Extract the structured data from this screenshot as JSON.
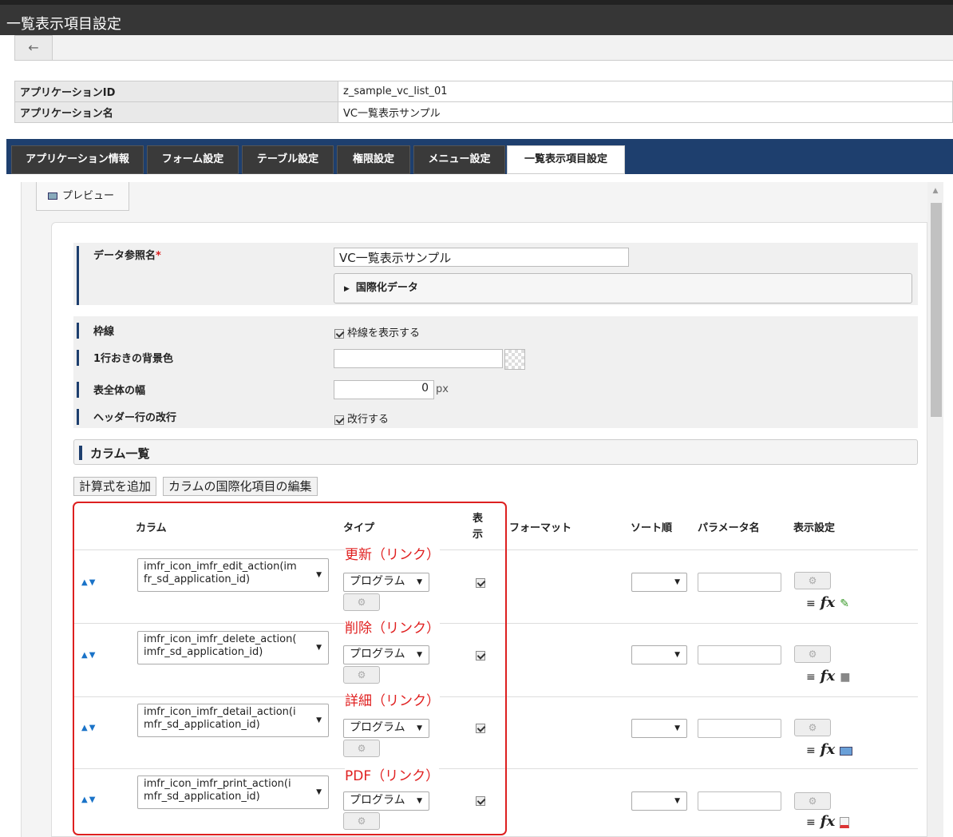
{
  "window": {
    "title": "一覧表示項目設定",
    "back_icon": "←"
  },
  "app_info": {
    "rows": [
      {
        "label": "アプリケーションID",
        "value": "z_sample_vc_list_01"
      },
      {
        "label": "アプリケーション名",
        "value": "VC一覧表示サンプル"
      }
    ]
  },
  "tabs": [
    {
      "label": "アプリケーション情報",
      "active": false
    },
    {
      "label": "フォーム設定",
      "active": false
    },
    {
      "label": "テーブル設定",
      "active": false
    },
    {
      "label": "権限設定",
      "active": false
    },
    {
      "label": "メニュー設定",
      "active": false
    },
    {
      "label": "一覧表示項目設定",
      "active": true
    }
  ],
  "preview_tab": "プレビュー",
  "form": {
    "data_ref_label": "データ参照名",
    "data_ref_required": "*",
    "data_ref_value": "VC一覧表示サンプル",
    "i18n_label": "国際化データ",
    "border_label": "枠線",
    "border_check": "枠線を表示する",
    "alt_bg_label": "1行おきの背景色",
    "table_width_label": "表全体の幅",
    "table_width_value": "0",
    "table_width_unit": "px",
    "header_wrap_label": "ヘッダー行の改行",
    "header_wrap_check": "改行する"
  },
  "column_section": {
    "title": "カラム一覧",
    "add_formula": "計算式を追加",
    "edit_i18n": "カラムの国際化項目の編集"
  },
  "grid": {
    "headers": {
      "column": "カラム",
      "type": "タイプ",
      "show": "表示",
      "format": "フォーマット",
      "sort": "ソート順",
      "param": "パラメータ名",
      "display": "表示設定"
    },
    "rows": [
      {
        "note": "更新（リンク）",
        "column_line1": "imfr_icon_imfr_edit_action(im",
        "column_line2": "fr_sd_application_id)",
        "type": "プログラム",
        "extra_icon": "pencil-icon"
      },
      {
        "note": "削除（リンク）",
        "column_line1": "imfr_icon_imfr_delete_action(",
        "column_line2": "imfr_sd_application_id)",
        "type": "プログラム",
        "extra_icon": "trash-icon"
      },
      {
        "note": "詳細（リンク）",
        "column_line1": "imfr_icon_imfr_detail_action(i",
        "column_line2": "mfr_sd_application_id)",
        "type": "プログラム",
        "extra_icon": "detail-icon"
      },
      {
        "note": "PDF（リンク）",
        "column_line1": "imfr_icon_imfr_print_action(i",
        "column_line2": "mfr_sd_application_id)",
        "type": "プログラム",
        "extra_icon": "print-icon"
      }
    ]
  },
  "colors": {
    "titlebar": "#363636",
    "tabbar": "#1e3f6e",
    "highlight": "#dd2020"
  }
}
